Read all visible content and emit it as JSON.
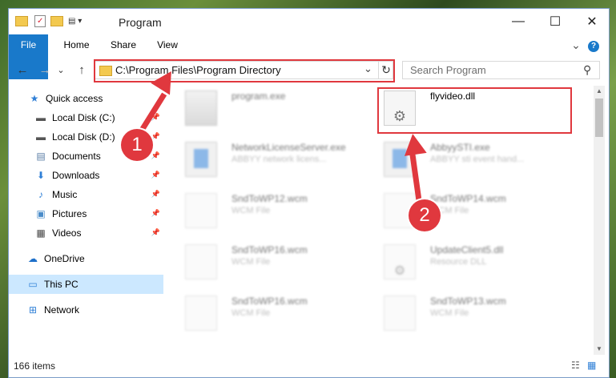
{
  "window": {
    "title": "Program",
    "controls": {
      "minimize": "—",
      "maximize": "☐",
      "close": "✕"
    }
  },
  "ribbon": {
    "tabs": [
      "File",
      "Home",
      "Share",
      "View"
    ],
    "expand": "⌄",
    "help": "?"
  },
  "address_bar": {
    "path": "C:\\Program Files\\Program Directory",
    "dropdown": "⌄",
    "refresh": "↻"
  },
  "search": {
    "placeholder": "Search Program",
    "icon": "⚲"
  },
  "nav": {
    "back": "←",
    "forward": "→",
    "recent": "⌄",
    "up": "↑"
  },
  "sidebar": {
    "items": [
      {
        "label": "Quick access",
        "icon": "★",
        "pinned": false
      },
      {
        "label": "Local Disk (C:)",
        "icon": "▬",
        "pinned": true
      },
      {
        "label": "Local Disk (D:)",
        "icon": "▬",
        "pinned": true
      },
      {
        "label": "Documents",
        "icon": "▤",
        "pinned": true
      },
      {
        "label": "Downloads",
        "icon": "⬇",
        "pinned": true
      },
      {
        "label": "Music",
        "icon": "♪",
        "pinned": true
      },
      {
        "label": "Pictures",
        "icon": "▣",
        "pinned": true
      },
      {
        "label": "Videos",
        "icon": "▦",
        "pinned": true
      },
      {
        "label": "OneDrive",
        "icon": "☁",
        "pinned": false
      },
      {
        "label": "This PC",
        "icon": "▭",
        "pinned": false,
        "selected": true
      },
      {
        "label": "Network",
        "icon": "⊞",
        "pinned": false
      }
    ],
    "pin_glyph": "📌"
  },
  "files": [
    {
      "name": "program.exe",
      "desc": "",
      "type": "exe-app"
    },
    {
      "name": "flyvideo.dll",
      "desc": "",
      "type": "dll",
      "highlighted": true
    },
    {
      "name": "NetworkLicenseServer.exe",
      "desc": "ABBYY network licens...",
      "type": "exe-blue"
    },
    {
      "name": "AbbyySTI.exe",
      "desc": "ABBYY sti event hand...",
      "type": "exe-blue"
    },
    {
      "name": "SndToWP12.wcm",
      "desc": "WCM File",
      "type": "doc"
    },
    {
      "name": "SndToWP14.wcm",
      "desc": "WCM File",
      "type": "doc"
    },
    {
      "name": "SndToWP16.wcm",
      "desc": "WCM File",
      "type": "doc"
    },
    {
      "name": "UpdateClient5.dll",
      "desc": "Resource DLL",
      "type": "dll"
    },
    {
      "name": "SndToWP16.wcm",
      "desc": "WCM File",
      "type": "doc"
    },
    {
      "name": "SndToWP13.wcm",
      "desc": "WCM File",
      "type": "doc"
    }
  ],
  "status": {
    "items_count": "166 items"
  },
  "annotations": {
    "badge1": "1",
    "badge2": "2",
    "color": "#e0383e"
  },
  "colors": {
    "file_tab": "#1979ca",
    "selected": "#cce8ff"
  }
}
